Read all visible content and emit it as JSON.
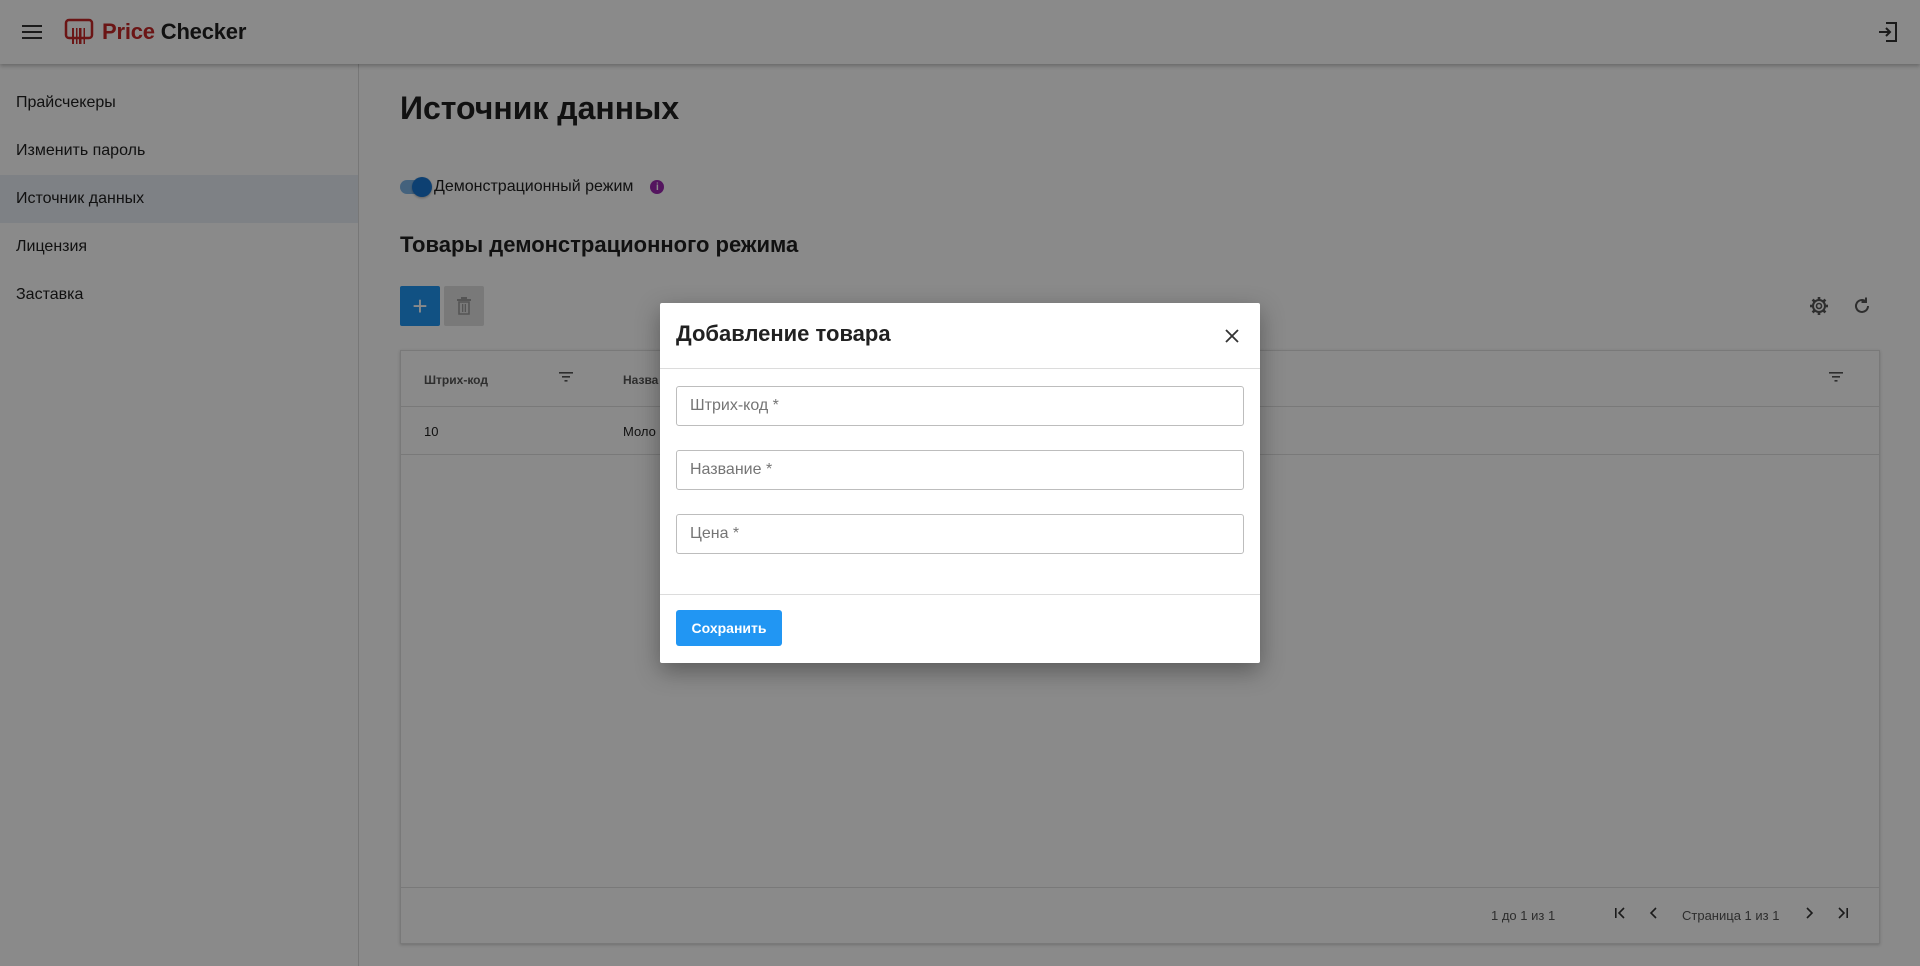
{
  "app": {
    "brand_price": "Price",
    "brand_checker": "Checker",
    "brand_color": "#c62828",
    "accent_color": "#2196f3"
  },
  "header": {
    "menu_icon": "menu-icon",
    "logout_icon": "logout-icon"
  },
  "sidebar": {
    "items": [
      {
        "label": "Прайсчекеры",
        "active": false
      },
      {
        "label": "Изменить пароль",
        "active": false
      },
      {
        "label": "Источник данных",
        "active": true
      },
      {
        "label": "Лицензия",
        "active": false
      },
      {
        "label": "Заставка",
        "active": false
      }
    ]
  },
  "main": {
    "title": "Источник данных",
    "demo_toggle": {
      "label": "Демонстрационный режим",
      "checked": true
    },
    "section_title": "Товары демонстрационного режима",
    "toolbar": {
      "add_label": "+",
      "delete_icon": "trash-icon",
      "settings_icon": "gear-icon",
      "refresh_icon": "refresh-icon"
    },
    "grid": {
      "columns": [
        "Штрих-код",
        "Назва"
      ],
      "rows": [
        {
          "barcode": "10",
          "name": "Моло"
        }
      ],
      "footer": {
        "row_summary": "1 до 1 из 1",
        "page_info": "Страница 1 из 1"
      }
    }
  },
  "modal": {
    "title": "Добавление товара",
    "fields": {
      "barcode_placeholder": "Штрих-код *",
      "name_placeholder": "Название *",
      "price_placeholder": "Цена *"
    },
    "save_label": "Сохранить"
  }
}
